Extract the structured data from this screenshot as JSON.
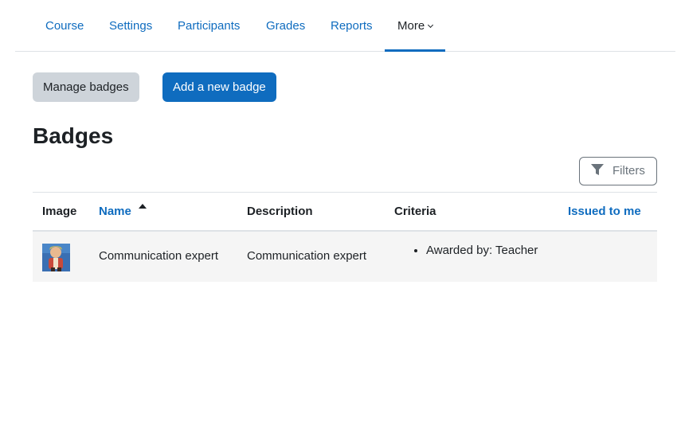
{
  "nav": {
    "items": [
      {
        "label": "Course"
      },
      {
        "label": "Settings"
      },
      {
        "label": "Participants"
      },
      {
        "label": "Grades"
      },
      {
        "label": "Reports"
      },
      {
        "label": "More"
      }
    ],
    "active": "More"
  },
  "actions": {
    "manage_label": "Manage badges",
    "add_label": "Add a new badge"
  },
  "page": {
    "title": "Badges"
  },
  "filters": {
    "label": "Filters",
    "icon": "filter-icon"
  },
  "table": {
    "columns": [
      {
        "label": "Image",
        "sortable": false
      },
      {
        "label": "Name",
        "sortable": true,
        "sort": "ascending"
      },
      {
        "label": "Description",
        "sortable": false
      },
      {
        "label": "Criteria",
        "sortable": false
      },
      {
        "label": "Issued to me",
        "sortable": true
      }
    ],
    "rows": [
      {
        "image": "badge-image",
        "name": "Communication expert",
        "description": "Communication expert",
        "criteria": [
          "Awarded by: Teacher"
        ],
        "issued": ""
      }
    ]
  },
  "colors": {
    "primary": "#0f6cbf",
    "secondary": "#ced4da",
    "text": "#1d2125",
    "row_bg": "#f5f5f5"
  }
}
